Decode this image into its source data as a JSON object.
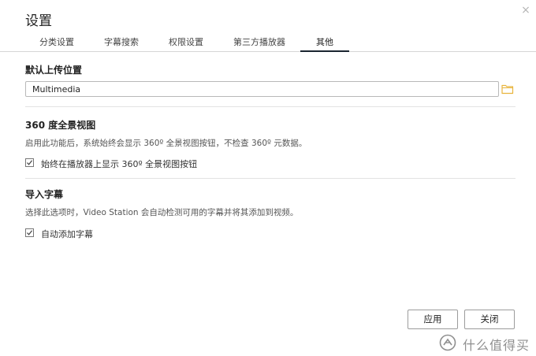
{
  "dialog": {
    "title": "设置",
    "close_glyph": "×"
  },
  "tabs": [
    {
      "label": "分类设置",
      "active": false
    },
    {
      "label": "字幕搜索",
      "active": false
    },
    {
      "label": "权限设置",
      "active": false
    },
    {
      "label": "第三方播放器",
      "active": false
    },
    {
      "label": "其他",
      "active": true
    }
  ],
  "upload": {
    "title": "默认上传位置",
    "path_value": "Multimedia",
    "browse_icon": "folder-icon"
  },
  "panorama": {
    "title": "360 度全景视图",
    "description": "启用此功能后，系统始终会显示 360º 全景视图按钮，不检查 360º 元数据。",
    "checkbox_label": "始终在播放器上显示 360º 全景视图按钮",
    "checked": true
  },
  "subtitles": {
    "title": "导入字幕",
    "description": "选择此选项时，Video Station 会自动检测可用的字幕并将其添加到视频。",
    "checkbox_label": "自动添加字幕",
    "checked": true
  },
  "footer": {
    "apply_label": "应用",
    "close_label": "关闭"
  },
  "watermark": {
    "text": "什么值得买"
  },
  "colors": {
    "folder_icon": "#e8b43c",
    "active_tab_underline": "#1a2530",
    "divider": "#e2e2e2"
  }
}
